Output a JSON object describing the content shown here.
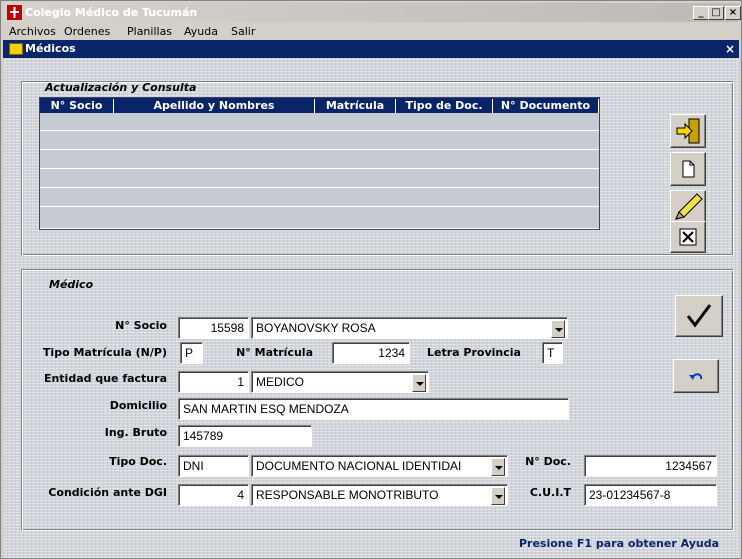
{
  "window": {
    "title": "Colegio Médico de Tucumán",
    "minimize": "_",
    "maximize": "□",
    "close": "×"
  },
  "menu": [
    {
      "label": "Archivos"
    },
    {
      "label": "Ordenes"
    },
    {
      "label": "Planillas"
    },
    {
      "label": "Ayuda"
    },
    {
      "label": "Salir"
    }
  ],
  "child": {
    "title": "Médicos",
    "close": "×"
  },
  "consulta": {
    "title": "Actualización y Consulta",
    "columns": [
      "N° Socio",
      "Apellido y Nombres",
      "Matrícula",
      "Tipo de Doc.",
      "N° Documento"
    ]
  },
  "medico": {
    "title": "Médico",
    "socio_label": "N° Socio",
    "socio_num": "15598",
    "socio_nombre": "BOYANOVSKY ROSA",
    "tipo_mat_label": "Tipo Matrícula (N/P)",
    "tipo_mat": "P",
    "nmat_label": "N° Matrícula",
    "nmat": "1234",
    "letra_label": "Letra Provincia",
    "letra": "T",
    "entidad_label": "Entidad que factura",
    "entidad_num": "1",
    "entidad_nombre": "MEDICO",
    "domicilio_label": "Domicilio",
    "domicilio": "SAN MARTIN ESQ MENDOZA",
    "ingbruto_label": "Ing. Bruto",
    "ingbruto": "145789",
    "tipodoc_label": "Tipo Doc.",
    "tipodoc": "DNI",
    "tipodoc_desc": "DOCUMENTO NACIONAL IDENTIDAI",
    "ndoc_label": "N° Doc.",
    "ndoc": "1234567",
    "cond_label": "Condición ante DGI",
    "cond_num": "4",
    "cond_desc": "RESPONSABLE MONOTRIBUTO",
    "cuit_label": "C.U.I.T",
    "cuit": "23-01234567-8"
  },
  "status": "Presione F1 para obtener Ayuda"
}
